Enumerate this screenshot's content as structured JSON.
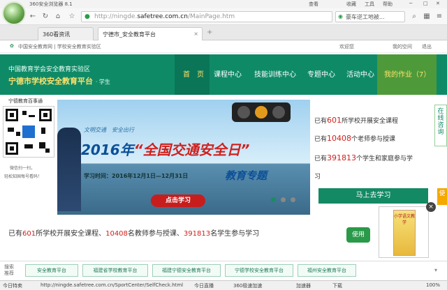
{
  "browser": {
    "title": "360安全浏览器 8.1",
    "menu": [
      "查看",
      "收藏",
      "工具",
      "帮助"
    ],
    "url_prefix": "http://ningde.",
    "url_host": "safetree.com.cn",
    "url_path": "/MainPage.htm",
    "search_text": "豪车逆工地被...",
    "tabs": [
      "360看资讯",
      "宁德市_安全教育平台"
    ]
  },
  "site": {
    "top_links": "中国安全教育网 | 学校安全教育实验区",
    "top_right": [
      "欢迎您",
      "",
      "我的空间",
      "退出"
    ],
    "org_line": "中国教育学会安全教育实验区",
    "platform_name": "宁德市学校安全教育平台",
    "role": "· 学生",
    "nav": [
      "首　页",
      "课程中心",
      "技能训练中心",
      "专题中心",
      "活动中心",
      "我的作业（7）"
    ]
  },
  "qr": {
    "caption": "宁德教育百事通",
    "tip1": "微信扫一扫，",
    "tip2": "轻松知国每号看码！"
  },
  "banner": {
    "slogan": "文明交通　安全出行",
    "headline_year": "2016年",
    "headline_main": "“全国交通安全日”",
    "study_time": "学习时间：2016年12月1日—12月31日",
    "subtitle": "教育专题",
    "cta": "点击学习"
  },
  "stats": {
    "schools_pre": "已有",
    "schools": "601",
    "schools_post": "所学校开展安全课程",
    "teachers_pre": "已有",
    "teachers": "10408",
    "teachers_post": "个老师参与授课",
    "students_pre": "已有",
    "students": "391813",
    "students_post": "个学生和家庭参与学",
    "students_post2": "习",
    "learn_button": "马上去学习",
    "sidetab": "在线咨询",
    "sidetab2": "使"
  },
  "summary": {
    "p1": "已有",
    "n1": "601",
    "p2": "所学校开展安全课程、",
    "n2": "10408",
    "p3": "名教师参与授课、",
    "n3": "391813",
    "p4": "名学生参与学习",
    "badge": "使用"
  },
  "popup": {
    "book_title": "小学语文教学",
    "close": "×"
  },
  "footer": {
    "label1": "搜索",
    "label2": "推荐",
    "links": [
      "安全教育平台",
      "福建省学校教育平台",
      "福建宁德安全教育平台",
      "宁德学校安全教育平台",
      "福州安全教育平台"
    ]
  },
  "statusbar": {
    "left": "今日特卖",
    "url": "http://ningde.safetree.com.cn/SportCenter/SelfCheck.html",
    "live": "今日直播",
    "speed": "360极速加速",
    "accel": "加速器",
    "download": "下载",
    "zoom": "100%"
  }
}
